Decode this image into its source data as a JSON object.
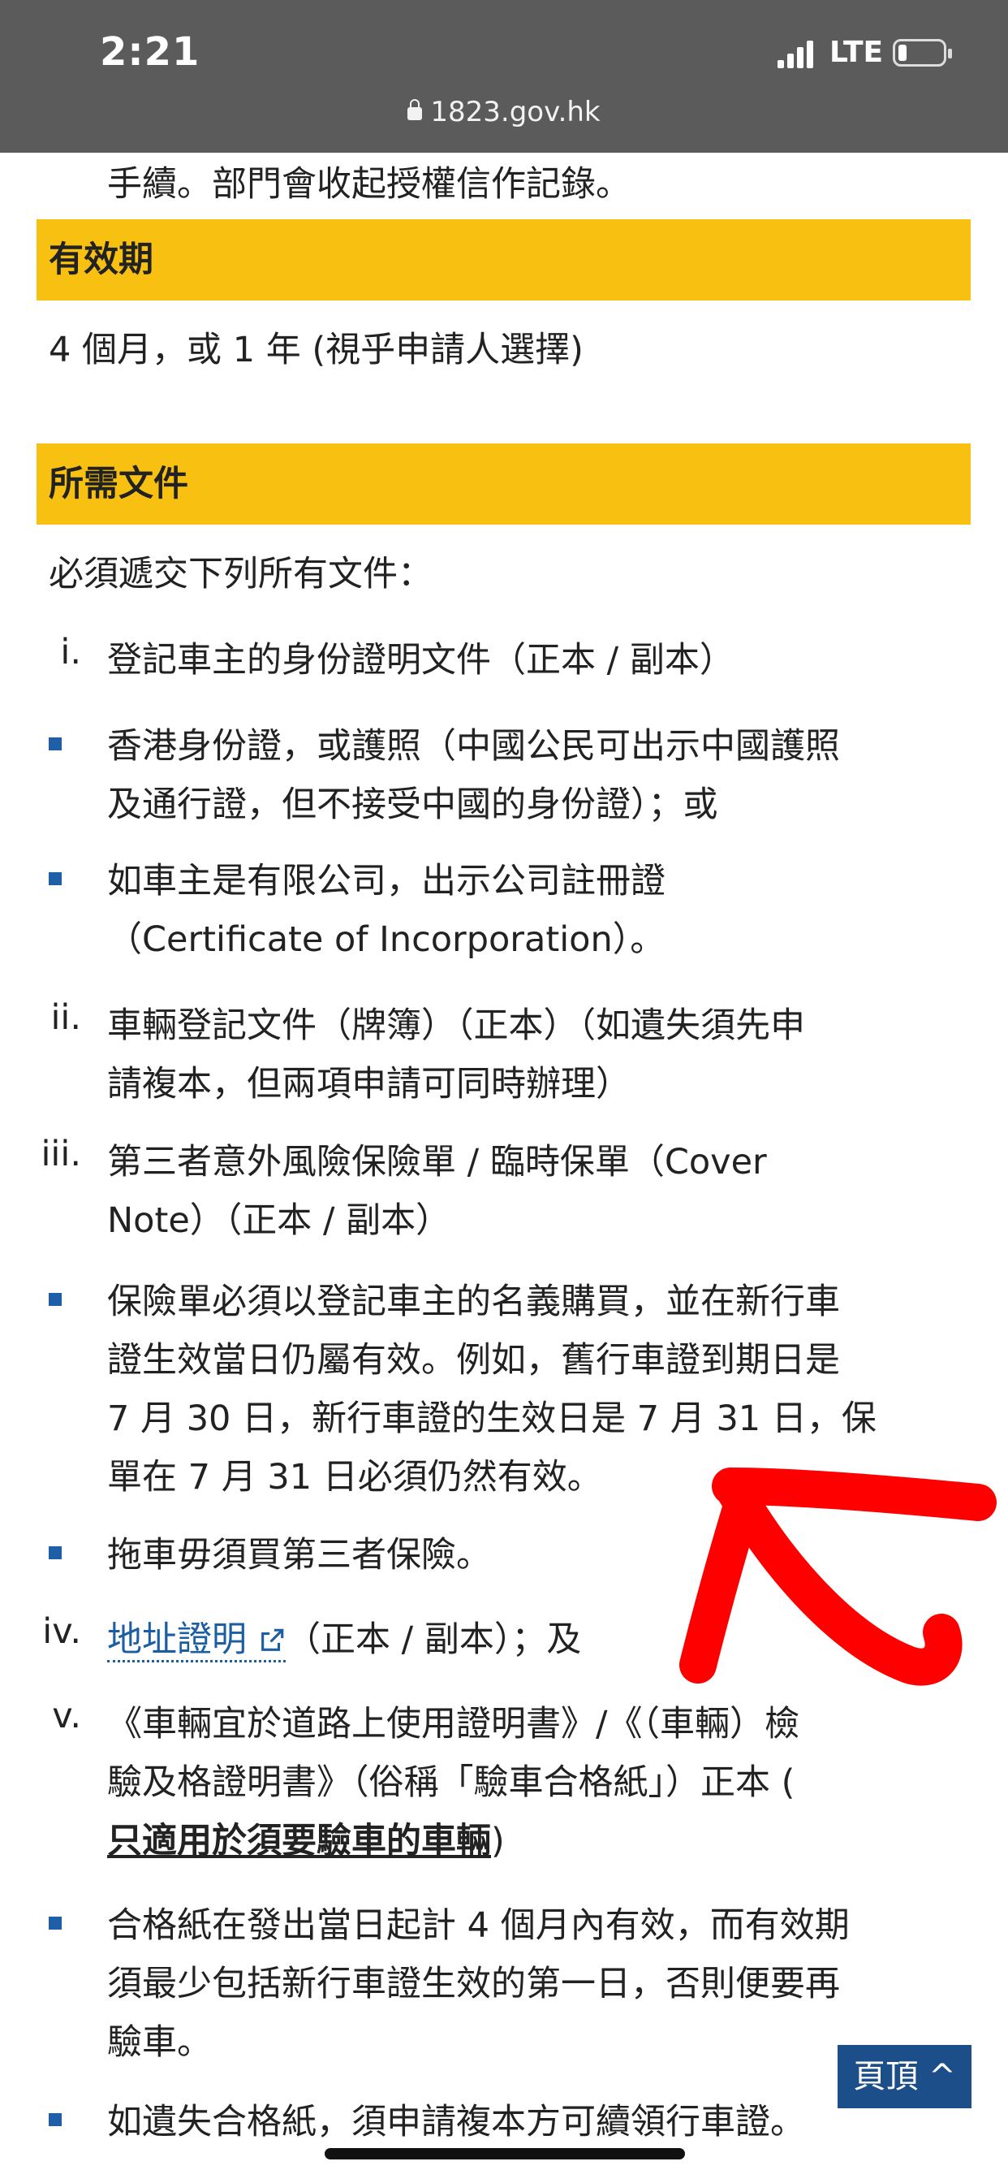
{
  "status_bar": {
    "time": "2:21",
    "network": "LTE",
    "url": "1823.gov.hk"
  },
  "content": {
    "top_line": "手續。部門會收起授權信作記錄。",
    "validity": {
      "heading": "有效期",
      "text": "4 個月，或 1 年 (視乎申請人選擇)"
    },
    "documents": {
      "heading": "所需文件",
      "intro": "必須遞交下列所有文件：",
      "item_i": {
        "num": "i.",
        "line1": "登記車主的身份證明文件（正本 / 副本）"
      },
      "bullet_1": {
        "line1": "香港身份證，或護照（中國公民可出示中國護照",
        "line2": "及通行證，但不接受中國的身份證）；或"
      },
      "bullet_2": {
        "line1": "如車主是有限公司，出示公司註冊證",
        "line2": "（Certificate of Incorporation）。"
      },
      "item_ii": {
        "num": "ii.",
        "line1": "車輛登記文件（牌簿）（正本）（如遺失須先申",
        "line2": "請複本，但兩項申請可同時辦理）"
      },
      "item_iii": {
        "num": "iii.",
        "line1": "第三者意外風險保險單 / 臨時保單（Cover",
        "line2": "Note）（正本 / 副本）"
      },
      "bullet_3": {
        "line1": "保險單必須以登記車主的名義購買，並在新行車",
        "line2": "證生效當日仍屬有效。例如，舊行車證到期日是",
        "line3": "7 月 30 日，新行車證的生效日是 7 月 31 日，保",
        "line4": "單在 7 月 31 日必須仍然有效。"
      },
      "bullet_4": {
        "line1": "拖車毋須買第三者保險。"
      },
      "item_iv": {
        "num": "iv.",
        "link": "地址證明",
        "rest": "（正本 / 副本）；及"
      },
      "item_v": {
        "num": "v.",
        "line1": "《車輛宜於道路上使用證明書》/《（車輛）檢",
        "line2": "驗及格證明書》（俗稱「驗車合格紙」）正本 (",
        "line3_bold": "只適用於須要驗車的車輛",
        "line3_end": ")"
      },
      "bullet_5": {
        "line1": "合格紙在發出當日起計 4 個月內有效，而有效期",
        "line2": "須最少包括新行車證生效的第一日，否則便要再",
        "line3": "驗車。"
      },
      "bullet_6": {
        "line1": "如遺失合格紙，須申請複本方可續領行車證。"
      }
    },
    "back_to_top": "頁頂 ^"
  },
  "colors": {
    "heading_bg": "#f8c111",
    "link": "#1b5ea3",
    "bullet": "#1f5fa8",
    "annotation": "#ff0000"
  }
}
